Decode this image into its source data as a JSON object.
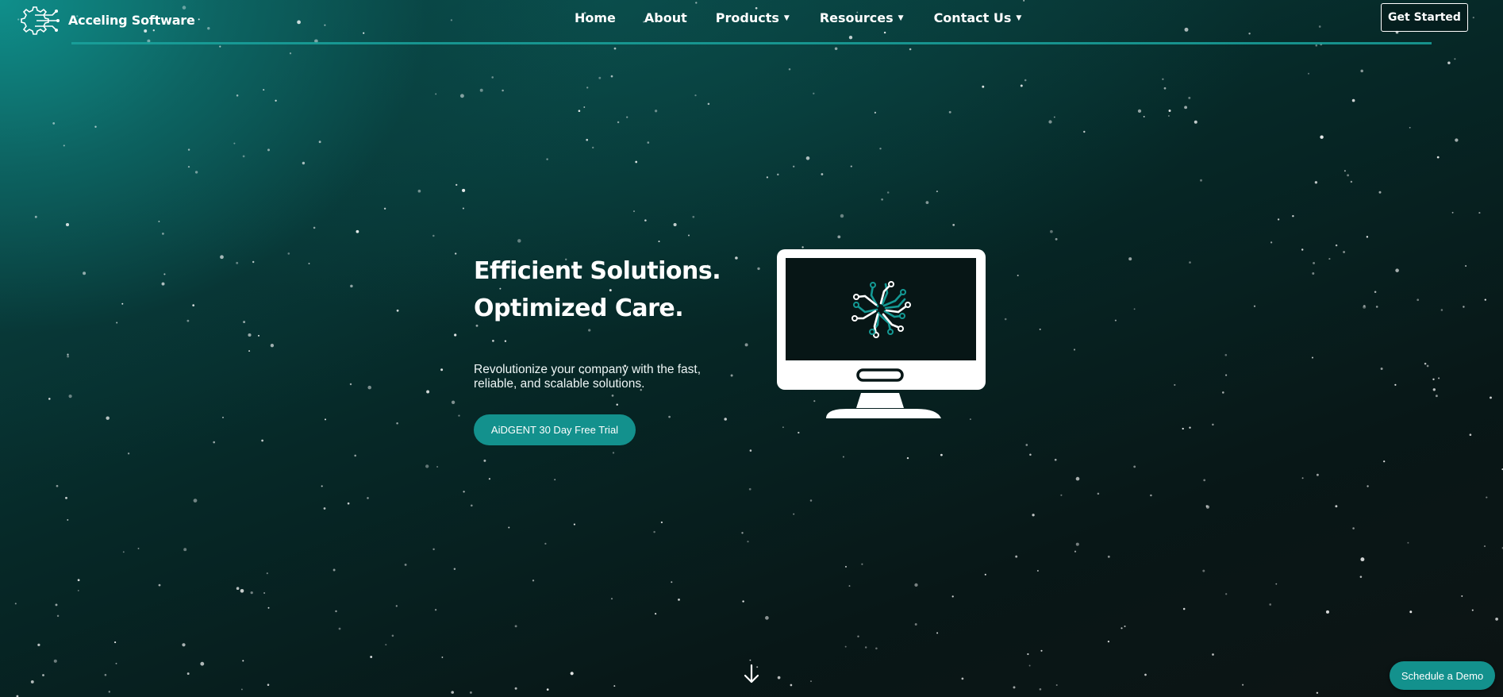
{
  "brand": {
    "name": "Acceling Software",
    "logo_icon": "circuit-gear-icon"
  },
  "nav": {
    "items": [
      {
        "label": "Home",
        "has_dropdown": false
      },
      {
        "label": "About",
        "has_dropdown": false
      },
      {
        "label": "Products",
        "has_dropdown": true
      },
      {
        "label": "Resources",
        "has_dropdown": true
      },
      {
        "label": "Contact Us",
        "has_dropdown": true
      }
    ],
    "dropdown_icon": "caret-down-icon",
    "cta_label": "Get Started"
  },
  "hero": {
    "title_line1": "Efficient Solutions.",
    "title_line2": "Optimized Care.",
    "subtitle": "Revolutionize your company with the fast, reliable, and scalable solutions.",
    "button_label": "AiDGENT 30 Day Free Trial",
    "illustration_icon": "monitor-circuit-icon"
  },
  "scroll_icon": "arrow-down-icon",
  "demo_button_label": "Schedule a Demo",
  "colors": {
    "accent": "#13918d",
    "background_dark": "#081717",
    "background_teal": "#0f8f8b",
    "text": "#ffffff"
  }
}
